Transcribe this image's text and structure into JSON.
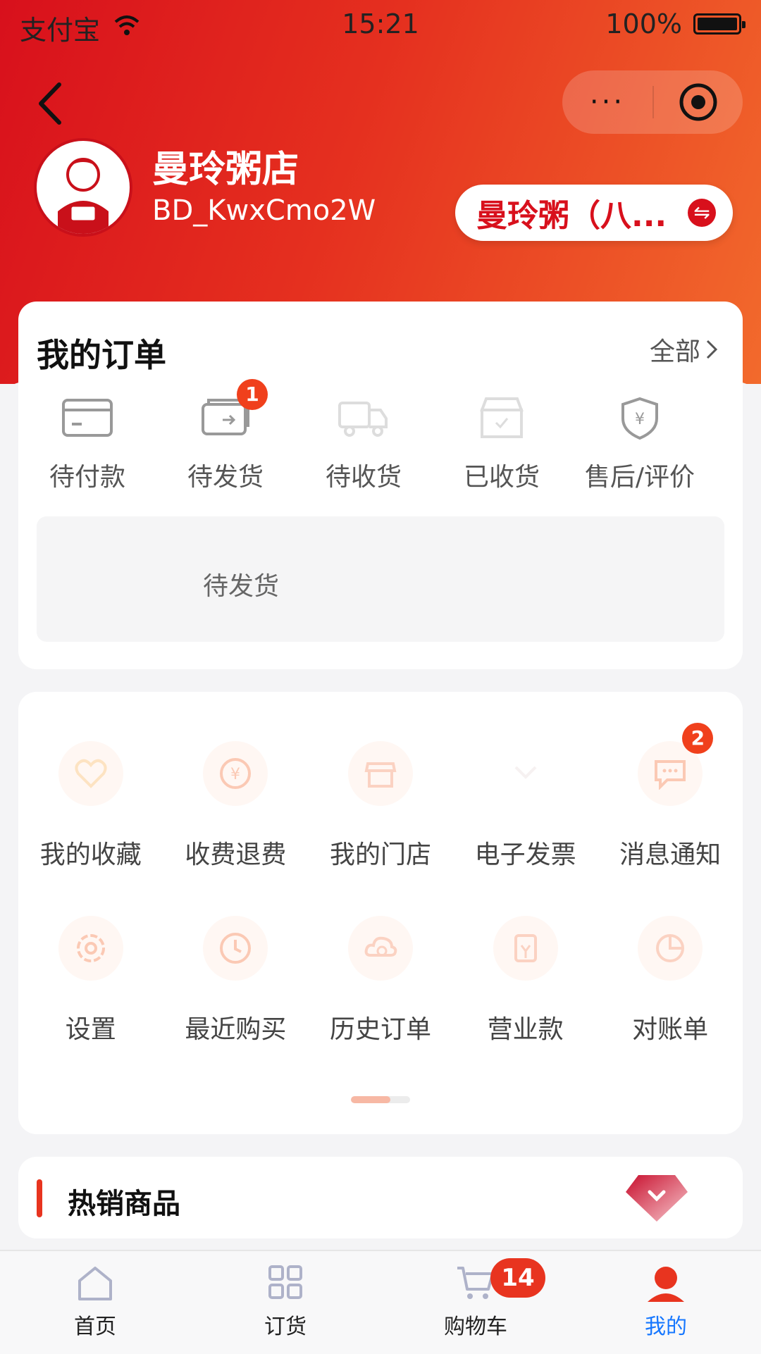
{
  "status_bar": {
    "carrier": "支付宝",
    "time": "15:21",
    "battery": "100%"
  },
  "header": {
    "shop_name": "曼玲粥店",
    "shop_id": "BD_KwxCmo2W",
    "store_selector": "曼玲粥（八...",
    "more_label": "···"
  },
  "orders": {
    "title": "我的订单",
    "all_label": "全部",
    "items": [
      {
        "label": "待付款",
        "icon": "wallet-card-icon"
      },
      {
        "label": "待发货",
        "icon": "shipping-card-icon",
        "badge": "1"
      },
      {
        "label": "待收货",
        "icon": "truck-icon"
      },
      {
        "label": "已收货",
        "icon": "received-box-icon"
      },
      {
        "label": "售后/评价",
        "icon": "shield-yen-icon"
      }
    ],
    "pending_text": "待发货"
  },
  "services": {
    "rows": [
      [
        {
          "label": "我的收藏",
          "icon": "heart-icon"
        },
        {
          "label": "收费退费",
          "icon": "yen-refresh-icon"
        },
        {
          "label": "我的门店",
          "icon": "store-icon"
        },
        {
          "label": "电子发票",
          "icon": "invoice-icon"
        },
        {
          "label": "消息通知",
          "icon": "message-icon",
          "badge": "2"
        }
      ],
      [
        {
          "label": "设置",
          "icon": "settings-icon"
        },
        {
          "label": "最近购买",
          "icon": "clock-icon"
        },
        {
          "label": "历史订单",
          "icon": "history-cloud-icon"
        },
        {
          "label": "营业款",
          "icon": "revenue-icon"
        },
        {
          "label": "对账单",
          "icon": "pie-chart-icon"
        }
      ]
    ]
  },
  "hot": {
    "title": "热销商品"
  },
  "tabbar": {
    "items": [
      {
        "label": "首页",
        "icon": "home-icon"
      },
      {
        "label": "订货",
        "icon": "grid-icon"
      },
      {
        "label": "购物车",
        "icon": "cart-icon",
        "badge": "14"
      },
      {
        "label": "我的",
        "icon": "user-icon",
        "active": true
      }
    ]
  },
  "colors": {
    "brand_red": "#d8101c",
    "accent_orange": "#f26a2c",
    "badge": "#f0401c",
    "tab_active": "#1677ff"
  }
}
